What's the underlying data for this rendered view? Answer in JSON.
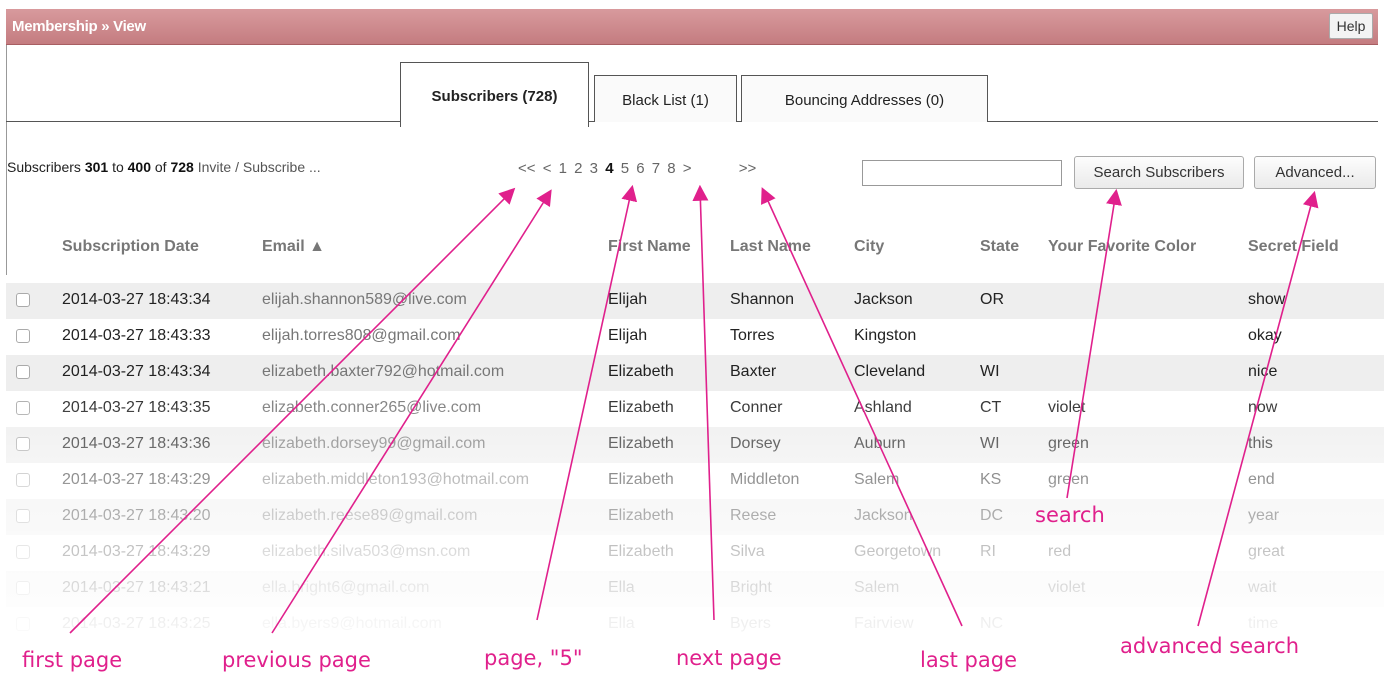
{
  "window": {
    "title": "Membership » View",
    "help_label": "Help"
  },
  "tabs": [
    {
      "label": "Subscribers (728)",
      "active": true
    },
    {
      "label": "Black List (1)",
      "active": false
    },
    {
      "label": "Bouncing Addresses (0)",
      "active": false
    }
  ],
  "summary": {
    "prefix": "Subscribers",
    "from": "301",
    "to_word": "to",
    "to": "400",
    "of_word": "of",
    "total": "728",
    "invite": "Invite / Subscribe ..."
  },
  "pager": {
    "first": "<<",
    "prev": "<",
    "pages": [
      "1",
      "2",
      "3",
      "4",
      "5",
      "6",
      "7",
      "8"
    ],
    "current": "4",
    "next": ">",
    "last": ">>"
  },
  "search": {
    "value": "",
    "button": "Search Subscribers",
    "advanced": "Advanced..."
  },
  "columns": [
    "Subscription Date",
    "Email ▲",
    "First Name",
    "Last Name",
    "City",
    "State",
    "Your Favorite Color",
    "Secret Field"
  ],
  "rows": [
    [
      "2014-03-27 18:43:34",
      "elijah.shannon589@live.com",
      "Elijah",
      "Shannon",
      "Jackson",
      "OR",
      "",
      "show"
    ],
    [
      "2014-03-27 18:43:33",
      "elijah.torres808@gmail.com",
      "Elijah",
      "Torres",
      "Kingston",
      "",
      "",
      "okay"
    ],
    [
      "2014-03-27 18:43:34",
      "elizabeth.baxter792@hotmail.com",
      "Elizabeth",
      "Baxter",
      "Cleveland",
      "WI",
      "",
      "nice"
    ],
    [
      "2014-03-27 18:43:35",
      "elizabeth.conner265@live.com",
      "Elizabeth",
      "Conner",
      "Ashland",
      "CT",
      "violet",
      "now"
    ],
    [
      "2014-03-27 18:43:36",
      "elizabeth.dorsey99@gmail.com",
      "Elizabeth",
      "Dorsey",
      "Auburn",
      "WI",
      "green",
      "this"
    ],
    [
      "2014-03-27 18:43:29",
      "elizabeth.middleton193@hotmail.com",
      "Elizabeth",
      "Middleton",
      "Salem",
      "KS",
      "green",
      "end"
    ],
    [
      "2014-03-27 18:43:20",
      "elizabeth.reese89@gmail.com",
      "Elizabeth",
      "Reese",
      "Jackson",
      "DC",
      "",
      "year"
    ],
    [
      "2014-03-27 18:43:29",
      "elizabeth.silva503@msn.com",
      "Elizabeth",
      "Silva",
      "Georgetown",
      "RI",
      "red",
      "great"
    ],
    [
      "2014-03-27 18:43:21",
      "ella.bright6@gmail.com",
      "Ella",
      "Bright",
      "Salem",
      "",
      "violet",
      "wait"
    ],
    [
      "2014-03-27 18:43:25",
      "ella.byers9@hotmail.com",
      "Ella",
      "Byers",
      "Fairview",
      "NC",
      "",
      "time"
    ]
  ],
  "annotations": {
    "first_page": "first page",
    "previous_page": "previous page",
    "page_5": "page, \"5\"",
    "next_page": "next page",
    "last_page": "last page",
    "search": "search",
    "advanced_search": "advanced search"
  },
  "colors": {
    "accent": "#e0208c",
    "titlebar": "#c98286"
  }
}
